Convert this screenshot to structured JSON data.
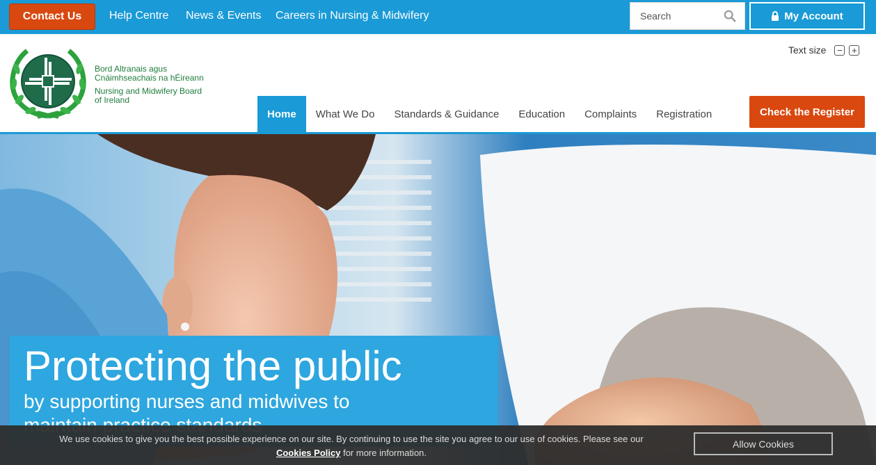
{
  "topbar": {
    "contact_label": "Contact Us",
    "links": [
      "Help Centre",
      "News & Events",
      "Careers in Nursing & Midwifery"
    ],
    "search_placeholder": "Search",
    "account_label": "My Account"
  },
  "header": {
    "org_irish_1": "Bord Altranais agus",
    "org_irish_2": "Cnáimhseachais na hÉireann",
    "org_english_1": "Nursing and Midwifery Board",
    "org_english_2": "of Ireland",
    "text_size_label": "Text size",
    "decrease_glyph": "−",
    "increase_glyph": "+"
  },
  "nav": {
    "items": [
      "Home",
      "What We Do",
      "Standards & Guidance",
      "Education",
      "Complaints",
      "Registration"
    ],
    "active_index": 0,
    "check_register_label": "Check the Register"
  },
  "hero": {
    "title": "Protecting the public",
    "subtitle": "by supporting nurses and midwives to",
    "subtitle_line2": "maintain practice standards"
  },
  "cookie": {
    "text_before": "We use cookies to give you the best possible experience on our site. By continuing to use the site you agree to our use of cookies. Please see our",
    "link_label": "Cookies Policy",
    "text_after": "for more information.",
    "button_label": "Allow Cookies"
  },
  "colors": {
    "brand_blue": "#1a9ad6",
    "accent_orange": "#d9480f",
    "logo_green": "#1f7d3c"
  }
}
